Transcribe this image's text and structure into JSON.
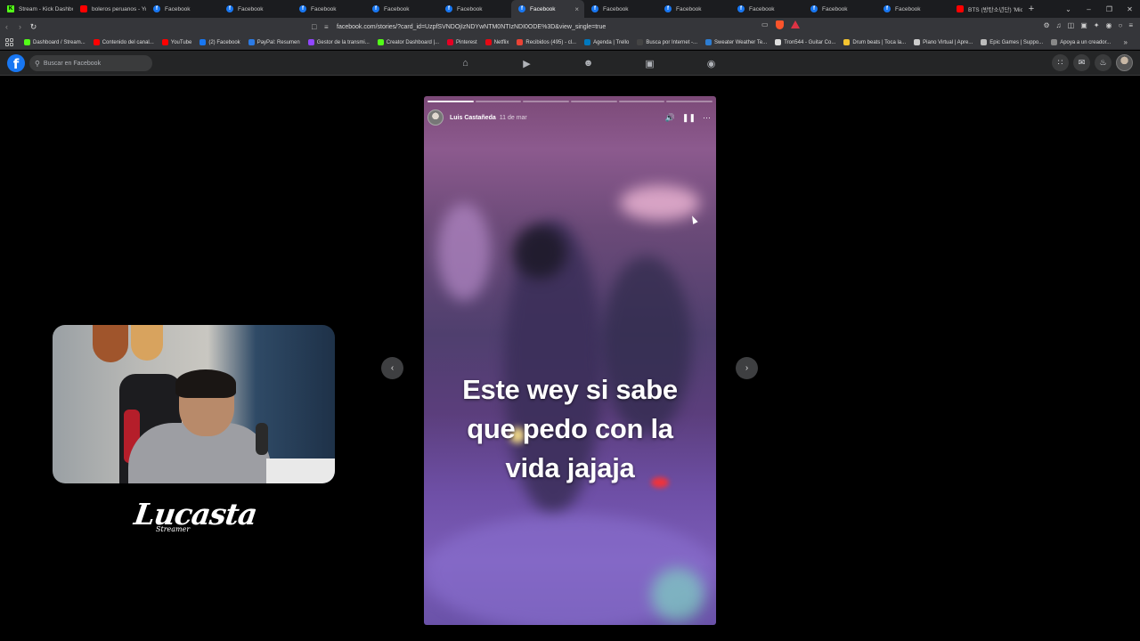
{
  "browser": {
    "tabs": [
      {
        "title": "Stream - Kick Dashbo",
        "icon": "kick-icon",
        "active": false
      },
      {
        "title": "boleros peruanos - Yo",
        "icon": "youtube-icon",
        "active": false
      },
      {
        "title": "Facebook",
        "icon": "facebook-icon",
        "active": false
      },
      {
        "title": "Facebook",
        "icon": "facebook-icon",
        "active": false
      },
      {
        "title": "Facebook",
        "icon": "facebook-icon",
        "active": false
      },
      {
        "title": "Facebook",
        "icon": "facebook-icon",
        "active": false
      },
      {
        "title": "Facebook",
        "icon": "facebook-icon",
        "active": false
      },
      {
        "title": "Facebook",
        "icon": "facebook-icon",
        "active": true
      },
      {
        "title": "Facebook",
        "icon": "facebook-icon",
        "active": false
      },
      {
        "title": "Facebook",
        "icon": "facebook-icon",
        "active": false
      },
      {
        "title": "Facebook",
        "icon": "facebook-icon",
        "active": false
      },
      {
        "title": "Facebook",
        "icon": "facebook-icon",
        "active": false
      },
      {
        "title": "Facebook",
        "icon": "facebook-icon",
        "active": false
      },
      {
        "title": "BTS (방탄소년단) 'Mic",
        "icon": "youtube-icon",
        "active": false
      }
    ],
    "url": "facebook.com/stories/?card_id=UzpfSVNDOjIzNDYwNTM0NTIzNDI0ODE%3D&view_single=true",
    "bookmarks": [
      {
        "label": "Dashboard / Stream...",
        "color": "#53fc18"
      },
      {
        "label": "Contenido del canal...",
        "color": "#ff0000"
      },
      {
        "label": "YouTube",
        "color": "#ff0000"
      },
      {
        "label": "(2) Facebook",
        "color": "#1877f2"
      },
      {
        "label": "PayPal: Resumen",
        "color": "#2c7be5"
      },
      {
        "label": "Gestor de la transmi...",
        "color": "#9146ff"
      },
      {
        "label": "Creator Dashboard |...",
        "color": "#53fc18"
      },
      {
        "label": "Pinterest",
        "color": "#e60023"
      },
      {
        "label": "Netflix",
        "color": "#e50914"
      },
      {
        "label": "Recibidos (495) - cl...",
        "color": "#ea4335"
      },
      {
        "label": "Agenda | Trello",
        "color": "#0079bf"
      },
      {
        "label": "Busca por Internet -...",
        "color": "#444444"
      },
      {
        "label": "Sweater Weather Te...",
        "color": "#2d7dd2"
      },
      {
        "label": "Tron544 - Guitar Co...",
        "color": "#dddddd"
      },
      {
        "label": "Drum beats | Toca la...",
        "color": "#f4c430"
      },
      {
        "label": "Piano Virtual | Apre...",
        "color": "#cccccc"
      },
      {
        "label": "Epic Games | Suppo...",
        "color": "#bbbbbb"
      },
      {
        "label": "Apoya a un creador...",
        "color": "#888888"
      }
    ]
  },
  "facebook": {
    "search_placeholder": "Buscar en Facebook",
    "logo_letter": "f",
    "nav_icons": [
      "home-icon",
      "video-icon",
      "friends-icon",
      "marketplace-icon",
      "gaming-icon"
    ],
    "right_icons": [
      "menu-grid-icon",
      "messenger-icon",
      "notifications-icon",
      "profile-avatar"
    ]
  },
  "story": {
    "user": "Luis Castañeda",
    "time": "11 de mar",
    "caption_lines": [
      "Este wey si sabe",
      "que pedo con la",
      "vida jajaja"
    ],
    "segments": 6,
    "segments_completed": 1
  },
  "overlay": {
    "logo_text": "Lucasta",
    "logo_sub": "Streamer"
  }
}
